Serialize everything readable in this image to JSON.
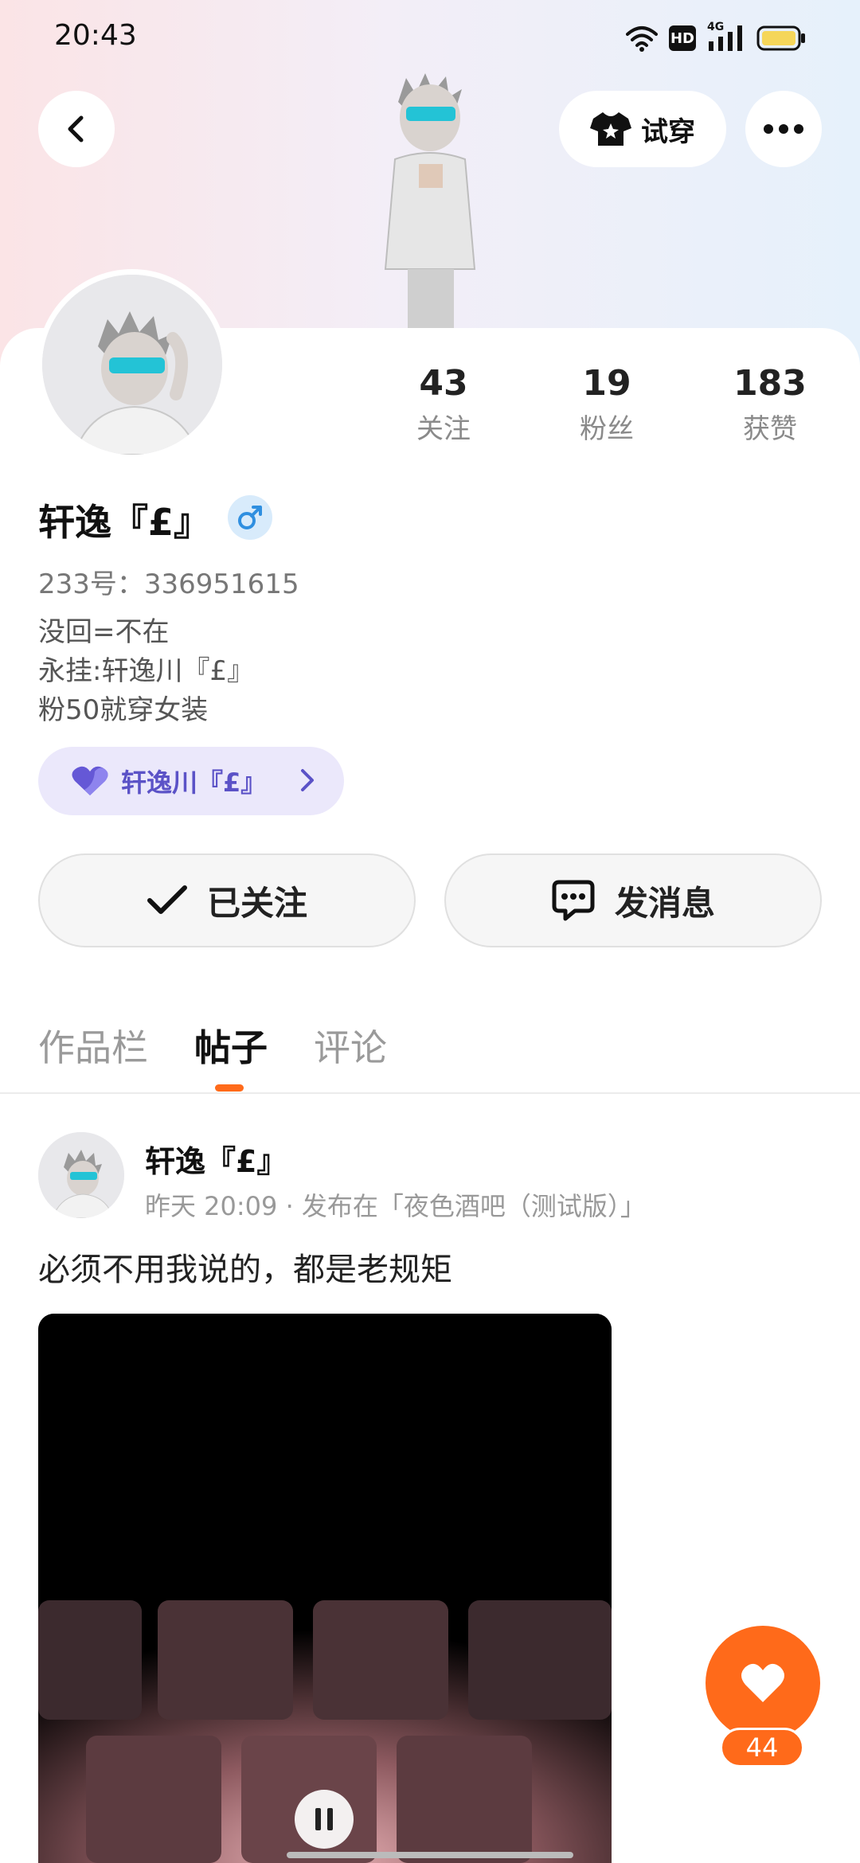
{
  "status_bar": {
    "time": "20:43",
    "hd_label": "HD",
    "network_label": "4G",
    "icons": [
      "wifi-icon",
      "hd-icon",
      "cellular-4g-icon",
      "battery-icon"
    ]
  },
  "header": {
    "back_icon": "chevron-left-icon",
    "tryon_label": "试穿",
    "more_icon": "more-horizontal-icon"
  },
  "profile": {
    "name": "轩逸『£』",
    "gender_icon": "male-icon",
    "uid": "233号：336951615",
    "bio": [
      "没回=不在",
      "永挂:轩逸川『£』",
      "粉50就穿女装"
    ],
    "stats": [
      {
        "value": "43",
        "label": "关注"
      },
      {
        "value": "19",
        "label": "粉丝"
      },
      {
        "value": "183",
        "label": "获赞"
      }
    ],
    "fan_badge": {
      "label": "轩逸川『£』",
      "icon": "heart-icon"
    }
  },
  "actions": {
    "follow_label": "已关注",
    "message_label": "发消息"
  },
  "tabs": [
    {
      "label": "作品栏",
      "active": false
    },
    {
      "label": "帖子",
      "active": true
    },
    {
      "label": "评论",
      "active": false
    }
  ],
  "post": {
    "author": "轩逸『£』",
    "meta": "昨天 20:09 · 发布在「夜色酒吧（测试版）」",
    "text": "必须不用我说的，都是老规矩",
    "video_state": "playing"
  },
  "like": {
    "count": "44"
  },
  "colors": {
    "accent": "#ff6a1a",
    "fan_badge_bg": "#ebe8fb",
    "fan_badge_text": "#5b52c7",
    "gender_bg": "#d8ebfb"
  }
}
